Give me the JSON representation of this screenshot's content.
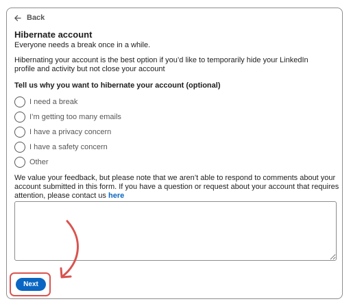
{
  "back": {
    "label": "Back",
    "icon": "arrow-left-icon"
  },
  "header": {
    "title": "Hibernate account",
    "subtitle": "Everyone needs a break once in a while."
  },
  "description": "Hibernating your account is the best option if you’d like to temporarily hide your LinkedIn profile and activity but not close your account",
  "question": "Tell us why you want to hibernate your account (optional)",
  "options": [
    {
      "label": "I need a break"
    },
    {
      "label": "I’m getting too many emails"
    },
    {
      "label": "I have a privacy concern"
    },
    {
      "label": "I have a safety concern"
    },
    {
      "label": "Other"
    }
  ],
  "feedback": {
    "text": "We value your feedback, but please note that we aren’t able to respond to comments about your account submitted in this form. If you have a question or request about your account that requires attention, please contact us ",
    "link_label": "here"
  },
  "textarea": {
    "value": "",
    "placeholder": ""
  },
  "next_button": {
    "label": "Next"
  },
  "colors": {
    "accent": "#0a66c2",
    "annotation": "#d9534f",
    "border": "#8c8c8c"
  }
}
